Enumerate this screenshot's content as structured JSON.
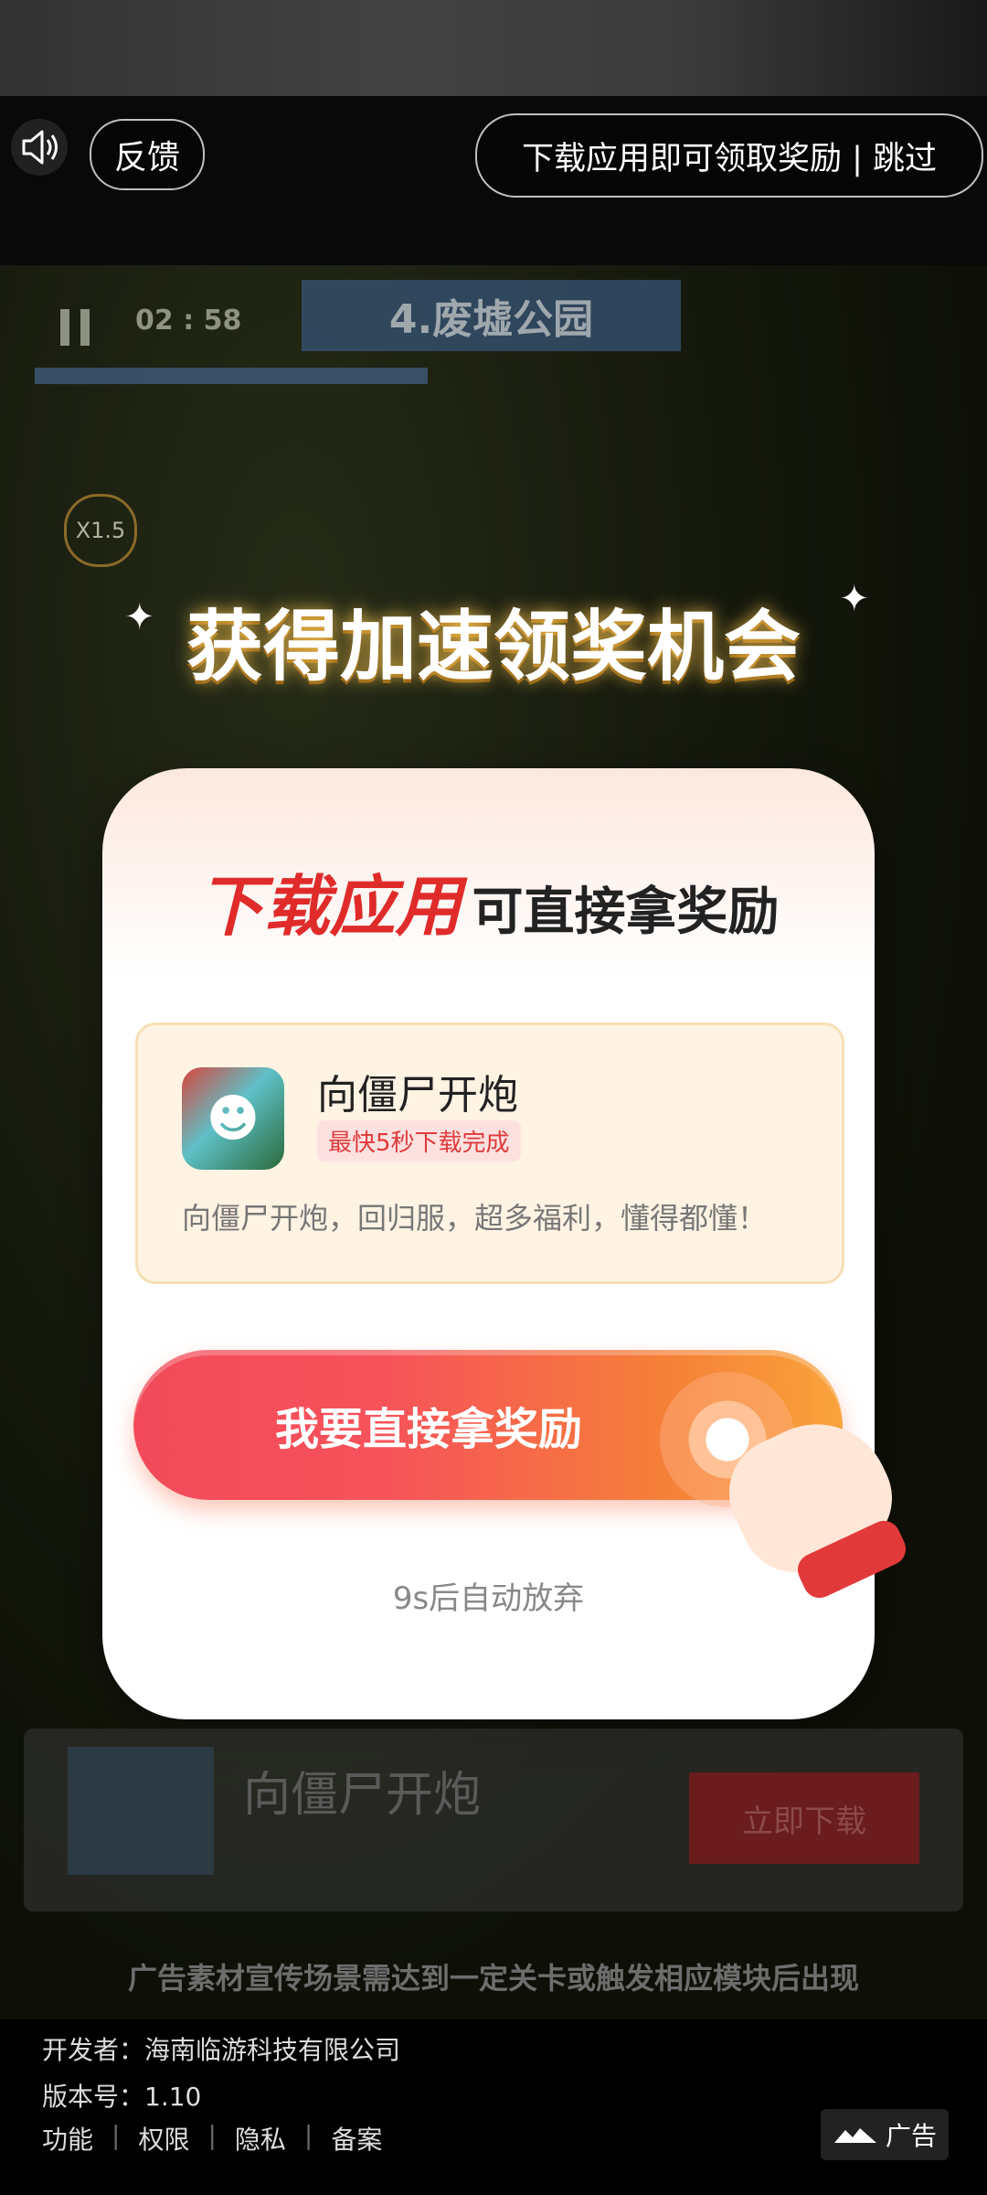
{
  "top_bar": {
    "feedback_label": "反馈",
    "skip_label": "下载应用即可领取奖励 | 跳过"
  },
  "game_hud": {
    "timer": "02 : 58",
    "level_title": "4.废墟公园",
    "multiplier": "X1.5"
  },
  "headline": "获得加速领奖机会",
  "modal": {
    "title_highlight": "下载应用",
    "title_rest": "可直接拿奖励",
    "app": {
      "name": "向僵尸开炮",
      "tag": "最快5秒下载完成",
      "description": "向僵尸开炮，回归服，超多福利，懂得都懂！"
    },
    "cta_label": "我要直接拿奖励",
    "countdown": "9s后自动放弃"
  },
  "background_card": {
    "app_name": "向僵尸开炮",
    "download_label": "立即下载"
  },
  "disclaimer": "广告素材宣传场景需达到一定关卡或触发相应模块后出现",
  "footer": {
    "developer": "开发者：海南临游科技有限公司",
    "version": "版本号：1.10",
    "links": [
      "功能",
      "权限",
      "隐私",
      "备案"
    ],
    "ad_label": "广告"
  },
  "colors": {
    "accent": "#e02b2b",
    "cta_start": "#f24a5a",
    "cta_end": "#f9a33b"
  }
}
